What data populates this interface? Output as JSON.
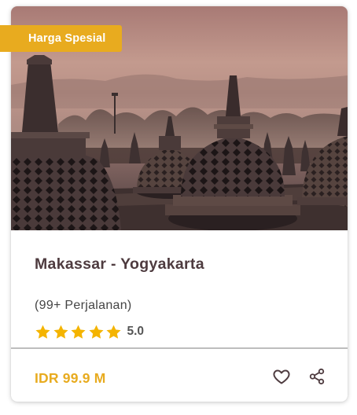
{
  "card": {
    "badge_label": "Harga Spesial",
    "image_alt": "Borobudur temple stupas at sunrise",
    "title": "Makassar - Yogyakarta",
    "trips_text": "(99+ Perjalanan)",
    "rating": {
      "stars": 5,
      "value": "5.0"
    },
    "price": "IDR 99.9 M",
    "actions": {
      "favorite_icon": "heart-icon",
      "share_icon": "share-icon"
    }
  },
  "colors": {
    "accent": "#e8ab1f",
    "title": "#4e3b3f",
    "star": "#f4b400",
    "divider": "#bdbdbd"
  }
}
